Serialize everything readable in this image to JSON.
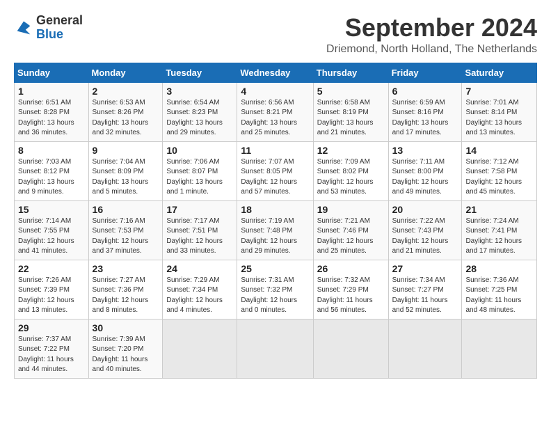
{
  "header": {
    "logo_line1": "General",
    "logo_line2": "Blue",
    "month": "September 2024",
    "location": "Driemond, North Holland, The Netherlands"
  },
  "weekdays": [
    "Sunday",
    "Monday",
    "Tuesday",
    "Wednesday",
    "Thursday",
    "Friday",
    "Saturday"
  ],
  "weeks": [
    [
      {
        "day": "1",
        "info": "Sunrise: 6:51 AM\nSunset: 8:28 PM\nDaylight: 13 hours\nand 36 minutes."
      },
      {
        "day": "2",
        "info": "Sunrise: 6:53 AM\nSunset: 8:26 PM\nDaylight: 13 hours\nand 32 minutes."
      },
      {
        "day": "3",
        "info": "Sunrise: 6:54 AM\nSunset: 8:23 PM\nDaylight: 13 hours\nand 29 minutes."
      },
      {
        "day": "4",
        "info": "Sunrise: 6:56 AM\nSunset: 8:21 PM\nDaylight: 13 hours\nand 25 minutes."
      },
      {
        "day": "5",
        "info": "Sunrise: 6:58 AM\nSunset: 8:19 PM\nDaylight: 13 hours\nand 21 minutes."
      },
      {
        "day": "6",
        "info": "Sunrise: 6:59 AM\nSunset: 8:16 PM\nDaylight: 13 hours\nand 17 minutes."
      },
      {
        "day": "7",
        "info": "Sunrise: 7:01 AM\nSunset: 8:14 PM\nDaylight: 13 hours\nand 13 minutes."
      }
    ],
    [
      {
        "day": "8",
        "info": "Sunrise: 7:03 AM\nSunset: 8:12 PM\nDaylight: 13 hours\nand 9 minutes."
      },
      {
        "day": "9",
        "info": "Sunrise: 7:04 AM\nSunset: 8:09 PM\nDaylight: 13 hours\nand 5 minutes."
      },
      {
        "day": "10",
        "info": "Sunrise: 7:06 AM\nSunset: 8:07 PM\nDaylight: 13 hours\nand 1 minute."
      },
      {
        "day": "11",
        "info": "Sunrise: 7:07 AM\nSunset: 8:05 PM\nDaylight: 12 hours\nand 57 minutes."
      },
      {
        "day": "12",
        "info": "Sunrise: 7:09 AM\nSunset: 8:02 PM\nDaylight: 12 hours\nand 53 minutes."
      },
      {
        "day": "13",
        "info": "Sunrise: 7:11 AM\nSunset: 8:00 PM\nDaylight: 12 hours\nand 49 minutes."
      },
      {
        "day": "14",
        "info": "Sunrise: 7:12 AM\nSunset: 7:58 PM\nDaylight: 12 hours\nand 45 minutes."
      }
    ],
    [
      {
        "day": "15",
        "info": "Sunrise: 7:14 AM\nSunset: 7:55 PM\nDaylight: 12 hours\nand 41 minutes."
      },
      {
        "day": "16",
        "info": "Sunrise: 7:16 AM\nSunset: 7:53 PM\nDaylight: 12 hours\nand 37 minutes."
      },
      {
        "day": "17",
        "info": "Sunrise: 7:17 AM\nSunset: 7:51 PM\nDaylight: 12 hours\nand 33 minutes."
      },
      {
        "day": "18",
        "info": "Sunrise: 7:19 AM\nSunset: 7:48 PM\nDaylight: 12 hours\nand 29 minutes."
      },
      {
        "day": "19",
        "info": "Sunrise: 7:21 AM\nSunset: 7:46 PM\nDaylight: 12 hours\nand 25 minutes."
      },
      {
        "day": "20",
        "info": "Sunrise: 7:22 AM\nSunset: 7:43 PM\nDaylight: 12 hours\nand 21 minutes."
      },
      {
        "day": "21",
        "info": "Sunrise: 7:24 AM\nSunset: 7:41 PM\nDaylight: 12 hours\nand 17 minutes."
      }
    ],
    [
      {
        "day": "22",
        "info": "Sunrise: 7:26 AM\nSunset: 7:39 PM\nDaylight: 12 hours\nand 13 minutes."
      },
      {
        "day": "23",
        "info": "Sunrise: 7:27 AM\nSunset: 7:36 PM\nDaylight: 12 hours\nand 8 minutes."
      },
      {
        "day": "24",
        "info": "Sunrise: 7:29 AM\nSunset: 7:34 PM\nDaylight: 12 hours\nand 4 minutes."
      },
      {
        "day": "25",
        "info": "Sunrise: 7:31 AM\nSunset: 7:32 PM\nDaylight: 12 hours\nand 0 minutes."
      },
      {
        "day": "26",
        "info": "Sunrise: 7:32 AM\nSunset: 7:29 PM\nDaylight: 11 hours\nand 56 minutes."
      },
      {
        "day": "27",
        "info": "Sunrise: 7:34 AM\nSunset: 7:27 PM\nDaylight: 11 hours\nand 52 minutes."
      },
      {
        "day": "28",
        "info": "Sunrise: 7:36 AM\nSunset: 7:25 PM\nDaylight: 11 hours\nand 48 minutes."
      }
    ],
    [
      {
        "day": "29",
        "info": "Sunrise: 7:37 AM\nSunset: 7:22 PM\nDaylight: 11 hours\nand 44 minutes."
      },
      {
        "day": "30",
        "info": "Sunrise: 7:39 AM\nSunset: 7:20 PM\nDaylight: 11 hours\nand 40 minutes."
      },
      {
        "day": "",
        "info": ""
      },
      {
        "day": "",
        "info": ""
      },
      {
        "day": "",
        "info": ""
      },
      {
        "day": "",
        "info": ""
      },
      {
        "day": "",
        "info": ""
      }
    ]
  ]
}
